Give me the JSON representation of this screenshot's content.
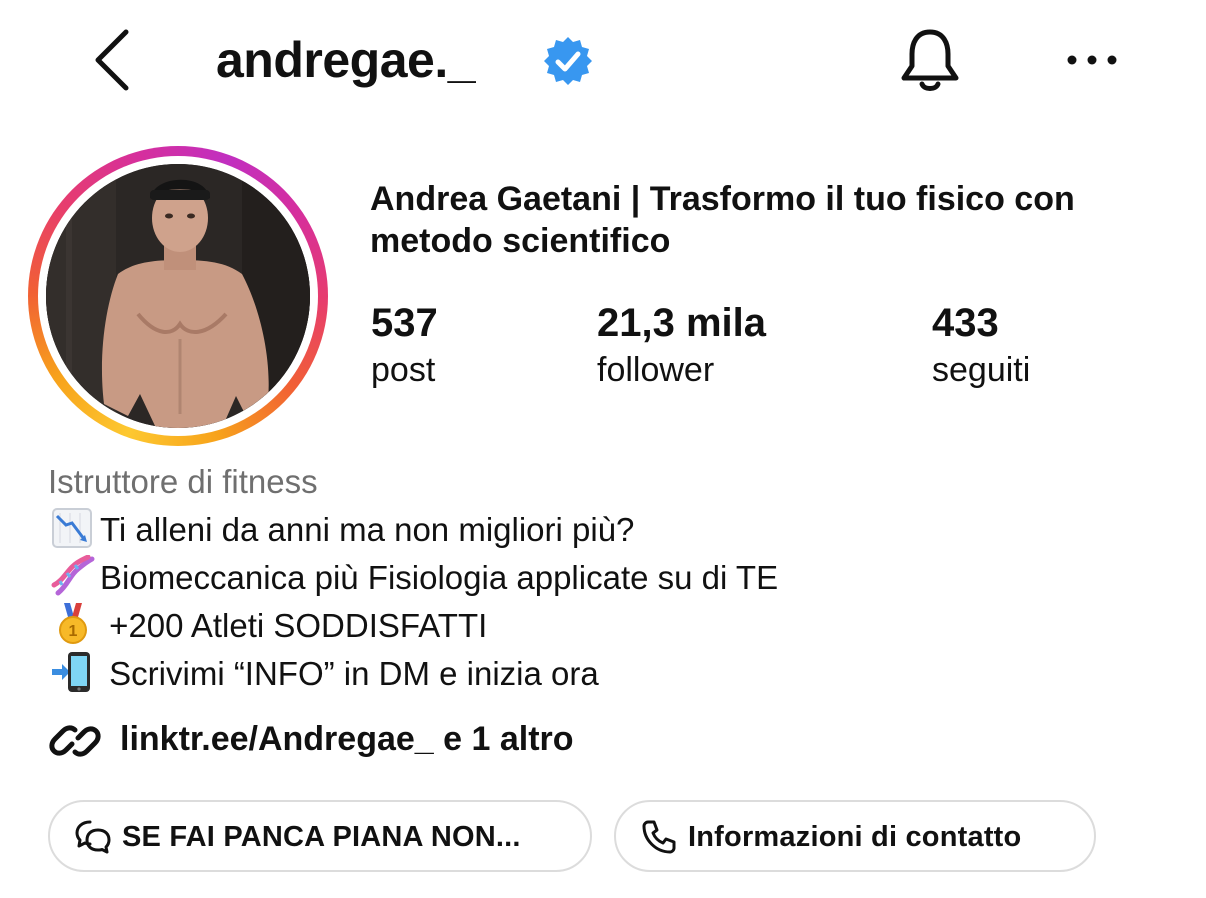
{
  "header": {
    "username": "andregae._",
    "back_icon": "chevron-left-icon",
    "verified_icon": "verified-badge-icon",
    "notifications_icon": "bell-icon",
    "more_icon": "more-horizontal-icon"
  },
  "profile": {
    "full_name": "Andrea Gaetani | Trasformo il tuo fisico con metodo scientifico",
    "stats": [
      {
        "value": "537",
        "label": "post"
      },
      {
        "value": "21,3 mila",
        "label": "follower"
      },
      {
        "value": "433",
        "label": "seguiti"
      }
    ]
  },
  "bio": {
    "category": "Istruttore di fitness",
    "lines": [
      {
        "emoji": "chart-decreasing-icon",
        "text": "Ti alleni da anni ma non migliori più?"
      },
      {
        "emoji": "dna-icon",
        "text": "Biomeccanica più Fisiologia applicate su di TE"
      },
      {
        "emoji": "first-place-medal-icon",
        "text": " +200 Atleti SODDISFATTI"
      },
      {
        "emoji": "mobile-phone-arrow-icon",
        "text": " Scrivimi “INFO” in DM e inizia ora"
      }
    ],
    "link": {
      "icon": "link-icon",
      "text": "linktr.ee/Andregae_ e 1 altro"
    }
  },
  "actions": {
    "message_button": {
      "icon": "chat-bubbles-icon",
      "label": "SE FAI PANCA PIANA NON..."
    },
    "contact_button": {
      "icon": "phone-icon",
      "label": "Informazioni di contatto"
    }
  },
  "colors": {
    "verified_blue": "#3897f0",
    "ring_start": "#fdc830",
    "ring_end": "#c12fc0",
    "category_gray": "#6f6f6f",
    "pill_border": "#dcdcdc"
  }
}
